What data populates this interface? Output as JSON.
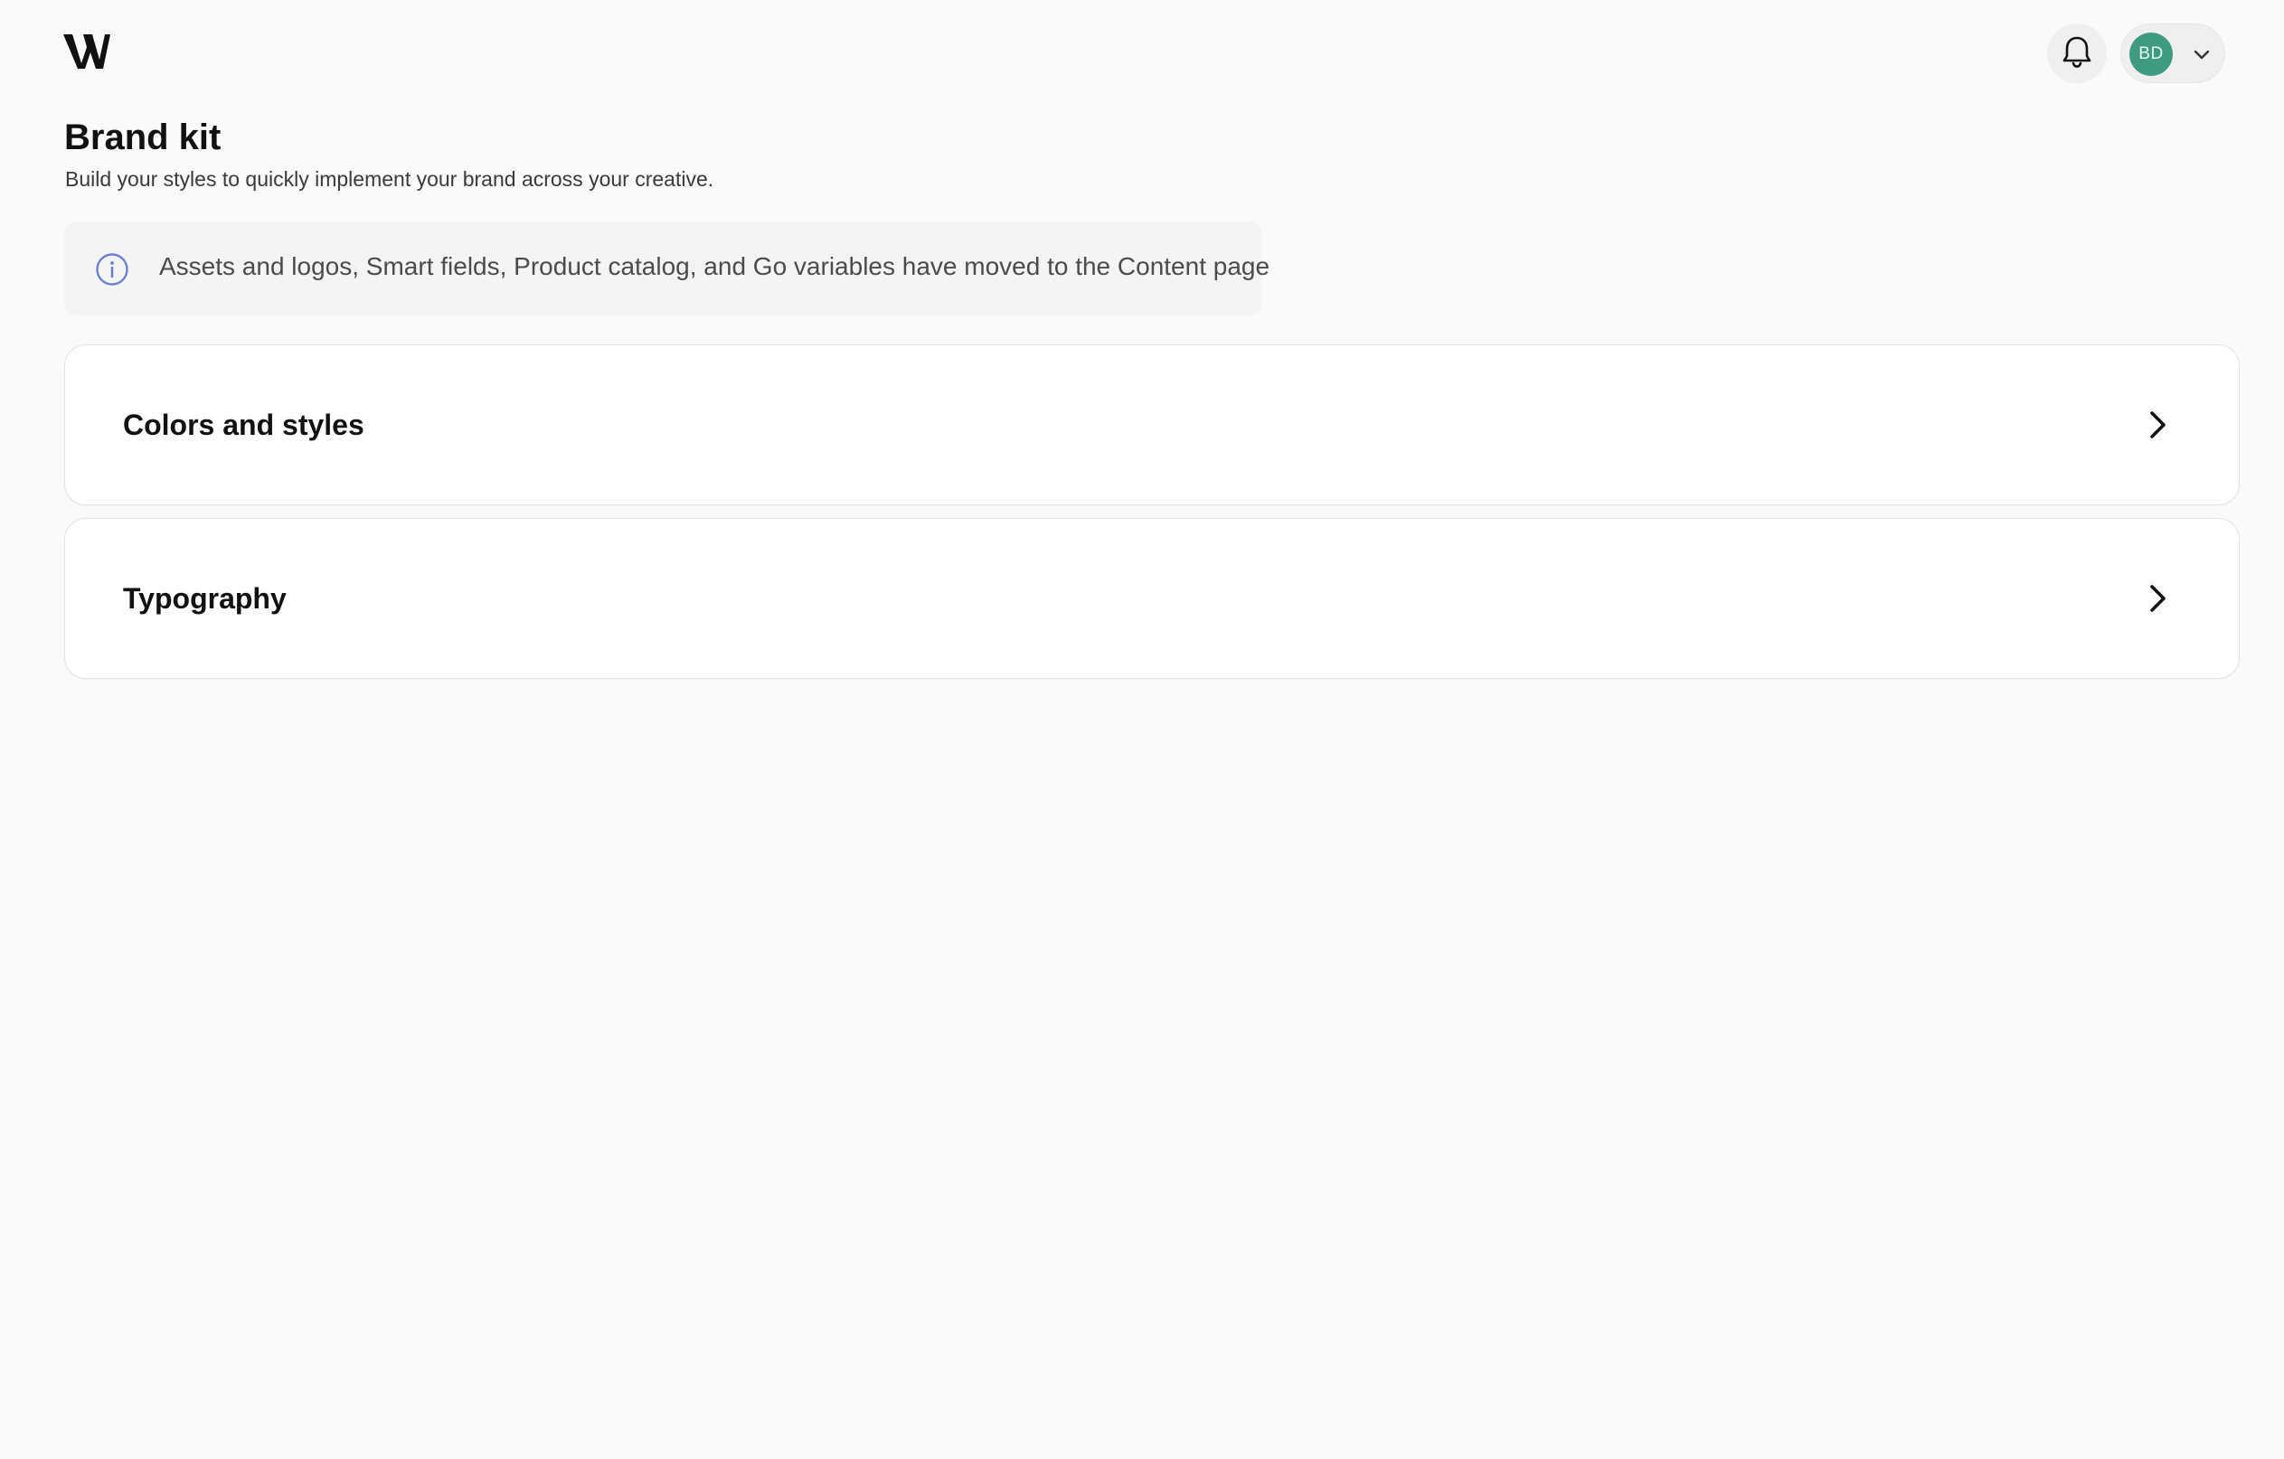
{
  "header": {
    "logo_icon": "w-brand-logo-icon",
    "notifications_icon": "bell-icon",
    "account": {
      "initials": "BD",
      "avatar_color": "#3f9a82",
      "menu_icon": "chevron-down-icon"
    }
  },
  "page": {
    "title": "Brand kit",
    "subtitle": "Build your styles to quickly implement your brand across your creative."
  },
  "info_banner": {
    "icon": "info-circle-icon",
    "icon_color": "#6b7fd1",
    "text": "Assets and logos, Smart fields, Product catalog, and Go variables have moved to the Content page"
  },
  "sections": [
    {
      "label": "Colors and styles",
      "icon": "chevron-right-icon"
    },
    {
      "label": "Typography",
      "icon": "chevron-right-icon"
    }
  ]
}
